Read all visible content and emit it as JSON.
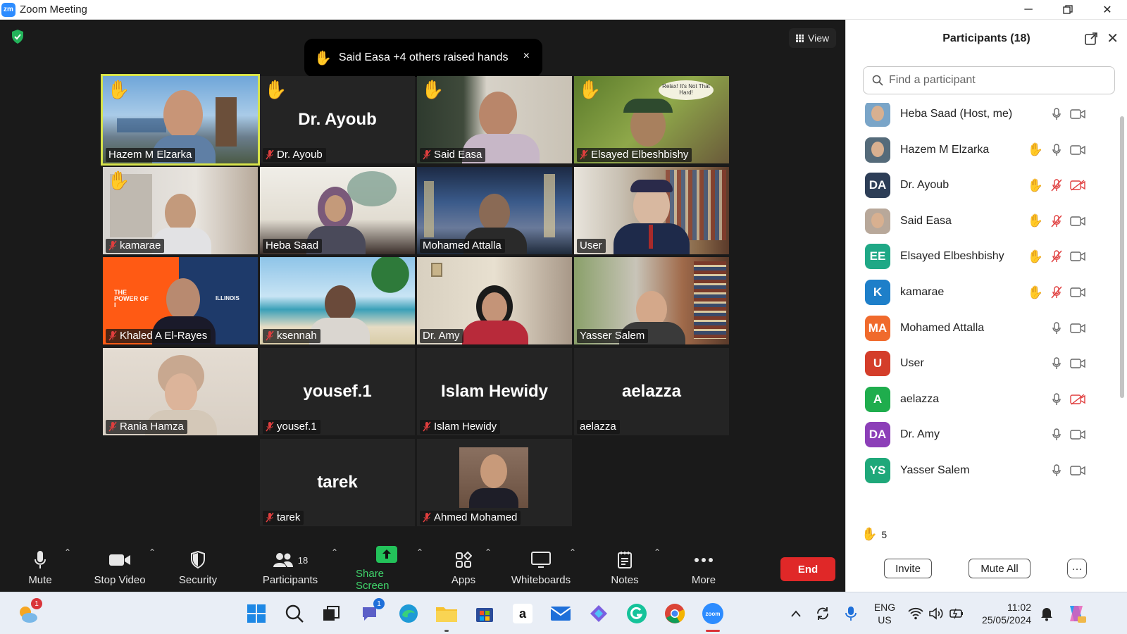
{
  "window": {
    "title": "Zoom Meeting",
    "logo": "zm"
  },
  "meeting": {
    "view_label": "View",
    "notice": {
      "text": "Said Easa +4 others raised hands",
      "close": "×"
    },
    "tiles": [
      {
        "name": "Hazem M Elzarka",
        "hand": true,
        "muted": false,
        "video": true,
        "active": true
      },
      {
        "name": "Dr. Ayoub",
        "hand": true,
        "muted": true,
        "video": false,
        "big_name": "Dr. Ayoub"
      },
      {
        "name": "Said Easa",
        "hand": true,
        "muted": true,
        "video": true
      },
      {
        "name": "Elsayed Elbeshbishy",
        "hand": true,
        "muted": true,
        "video": true,
        "bubble": "Relax! It's Not That Hard!"
      },
      {
        "name": "kamarae",
        "hand": true,
        "muted": true,
        "video": true
      },
      {
        "name": "Heba Saad",
        "hand": false,
        "muted": false,
        "video": true
      },
      {
        "name": "Mohamed Attalla",
        "hand": false,
        "muted": false,
        "video": true
      },
      {
        "name": "User",
        "hand": false,
        "muted": false,
        "video": true
      },
      {
        "name": "Khaled A El-Rayes",
        "hand": false,
        "muted": true,
        "video": true,
        "poster_text": "THE POWER OF I",
        "brand_text": "ILLINOIS"
      },
      {
        "name": "ksennah",
        "hand": false,
        "muted": true,
        "video": true
      },
      {
        "name": "Dr. Amy",
        "hand": false,
        "muted": false,
        "video": true
      },
      {
        "name": "Yasser Salem",
        "hand": false,
        "muted": false,
        "video": true
      },
      {
        "name": "Rania Hamza",
        "hand": false,
        "muted": true,
        "video": true
      },
      {
        "name": "yousef.1",
        "hand": false,
        "muted": true,
        "video": false,
        "big_name": "yousef.1"
      },
      {
        "name": "Islam Hewidy",
        "hand": false,
        "muted": true,
        "video": false,
        "big_name": "Islam Hewidy"
      },
      {
        "name": "aelazza",
        "hand": false,
        "muted": false,
        "video": false,
        "big_name": "aelazza"
      },
      {
        "name": "tarek",
        "hand": false,
        "muted": true,
        "video": false,
        "big_name": "tarek"
      },
      {
        "name": "Ahmed Mohamed",
        "hand": false,
        "muted": true,
        "video": false,
        "photo": true
      }
    ]
  },
  "toolbar": {
    "mute": "Mute",
    "stop_video": "Stop Video",
    "security": "Security",
    "participants": "Participants",
    "participants_count": "18",
    "share_screen": "Share Screen",
    "apps": "Apps",
    "whiteboards": "Whiteboards",
    "notes": "Notes",
    "more": "More",
    "end": "End"
  },
  "panel": {
    "title": "Participants (18)",
    "search_placeholder": "Find a participant",
    "participants": [
      {
        "name": "Heba Saad (Host, me)",
        "initials": "",
        "color": "#7aa5c8",
        "photo": true,
        "hand": false,
        "mic": "on",
        "cam": "on"
      },
      {
        "name": "Hazem M Elzarka",
        "initials": "",
        "color": "#556b7a",
        "photo": true,
        "hand": true,
        "mic": "on",
        "cam": "on"
      },
      {
        "name": "Dr. Ayoub",
        "initials": "DA",
        "color": "#2d3e57",
        "photo": false,
        "hand": true,
        "mic": "off",
        "cam": "off"
      },
      {
        "name": "Said Easa",
        "initials": "",
        "color": "#b8a89a",
        "photo": true,
        "hand": true,
        "mic": "off",
        "cam": "on"
      },
      {
        "name": "Elsayed Elbeshbishy",
        "initials": "EE",
        "color": "#1fa886",
        "photo": false,
        "hand": true,
        "mic": "off",
        "cam": "on"
      },
      {
        "name": "kamarae",
        "initials": "K",
        "color": "#1e7fc9",
        "photo": false,
        "hand": true,
        "mic": "off",
        "cam": "on"
      },
      {
        "name": "Mohamed Attalla",
        "initials": "MA",
        "color": "#f06a2c",
        "photo": false,
        "hand": false,
        "mic": "on",
        "cam": "on"
      },
      {
        "name": "User",
        "initials": "U",
        "color": "#d43d2a",
        "photo": false,
        "hand": false,
        "mic": "on",
        "cam": "on"
      },
      {
        "name": "aelazza",
        "initials": "A",
        "color": "#1fad4d",
        "photo": false,
        "hand": false,
        "mic": "on",
        "cam": "off"
      },
      {
        "name": "Dr. Amy",
        "initials": "DA",
        "color": "#8c3fb8",
        "photo": false,
        "hand": false,
        "mic": "on",
        "cam": "on"
      },
      {
        "name": "Yasser Salem",
        "initials": "YS",
        "color": "#1fa87a",
        "photo": false,
        "hand": false,
        "mic": "on",
        "cam": "on"
      }
    ],
    "hand_count": "5",
    "invite": "Invite",
    "mute_all": "Mute All",
    "more": "···"
  },
  "taskbar": {
    "weather_badge": "1",
    "chat_badge": "1",
    "lang_top": "ENG",
    "lang_bottom": "US",
    "time": "11:02",
    "date": "25/05/2024",
    "amazon": "a",
    "zoom": "zoom"
  }
}
